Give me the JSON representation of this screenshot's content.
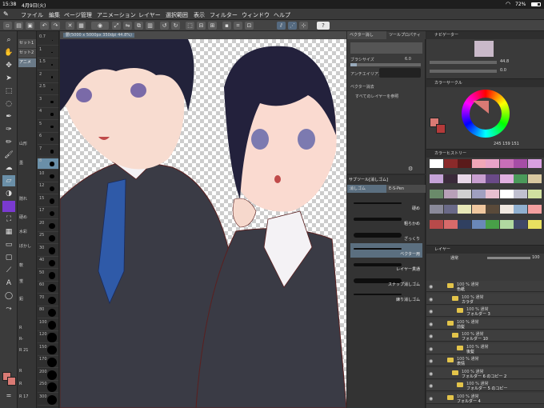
{
  "status_bar": {
    "time": "15:38",
    "date": "4月9日(火)",
    "battery": "72%"
  },
  "menu": [
    "ファイル",
    "編集",
    "ページ管理",
    "アニメーション",
    "レイヤー",
    "選択範囲",
    "表示",
    "フィルター",
    "ウィンドウ",
    "ヘルプ"
  ],
  "canvas": {
    "tab_label": "鬱(5000 x 5000px 350dpi 44.8%)"
  },
  "subtool_tabs": [
    "セット1",
    "セット2",
    "アニメ"
  ],
  "subtool_labels": [
    "山形",
    "墨",
    "隠れ",
    "硬め",
    "水彩",
    "ぼかし",
    "軟",
    "蛍",
    "鉛",
    "R",
    "R-",
    "R 21",
    "R",
    "R",
    "R 17"
  ],
  "brush_sizes": [
    "0.7",
    "1",
    "1.5",
    "2",
    "2.5",
    "3",
    "4",
    "5",
    "6",
    "7",
    "8",
    "10",
    "12",
    "15",
    "17",
    "20",
    "25",
    "30",
    "40",
    "50",
    "60",
    "70",
    "80",
    "100",
    "120",
    "150",
    "170",
    "200",
    "250",
    "300"
  ],
  "tool_property": {
    "tabs": [
      "ベクター消し",
      "ツールプロパティ"
    ],
    "brush_size_label": "ブラシサイズ",
    "brush_size_value": "6.0",
    "antialias_label": "アンチエイリアス",
    "vector_erase_label": "ベクター消去",
    "all_layers_label": "すべてのレイヤーを参照"
  },
  "subtool_panel": {
    "title": "サブツール[消しゴム]",
    "tabs": [
      "消しゴム",
      "E-S-Pen"
    ],
    "brushes": [
      "硬め",
      "粗らかめ",
      "ざっくり",
      "ベクター用",
      "レイヤー貫通",
      "スナップ消しゴム",
      "練り消しゴム"
    ]
  },
  "navigator": {
    "title": "ナビゲーター",
    "zoom": "44.8",
    "angle": "0.0"
  },
  "color_circle": {
    "title": "カラーサークル",
    "readout": "245 159 151"
  },
  "color_history": {
    "title": "カラーヒストリー"
  },
  "layers": {
    "title": "レイヤー",
    "blend": "通常",
    "opacity": "100",
    "rows": [
      {
        "mode": "100 % 通常",
        "name": "色紙"
      },
      {
        "mode": "100 % 通常",
        "name": "カラダ"
      },
      {
        "mode": "100 % 通常",
        "name": "フォルダー 3"
      },
      {
        "mode": "100 % 通常",
        "name": "前髪"
      },
      {
        "mode": "100 % 通常",
        "name": "フォルダー 10"
      },
      {
        "mode": "100 % 通常",
        "name": "後髪"
      },
      {
        "mode": "100 % 通常",
        "name": "表情"
      },
      {
        "mode": "100 % 通常",
        "name": "フォルダー 6 のコピー 2"
      },
      {
        "mode": "100 % 通常",
        "name": "フォルダー 5 のコピー"
      },
      {
        "mode": "100 % 通常",
        "name": "フォルダー 4"
      }
    ]
  },
  "colors": {
    "main": "#d97a74",
    "sub": "#d97a74",
    "history": [
      "#ffffff",
      "#8b2a2a",
      "#5a1a1a",
      "#f2a7b8",
      "#e9a3c8",
      "#c86fb8",
      "#a64da6",
      "#d8a0e0",
      "#c5a3d8",
      "#3a2a3a",
      "#e8d8e8",
      "#c89fd0",
      "#6a4a88",
      "#e0b0e0",
      "#4a9a5a",
      "#d8c8a0",
      "#6a8a6a",
      "#b8a0b8",
      "#d0d0d0",
      "#a0a0c0",
      "#e8c0d0",
      "#ffffff",
      "#c0c0d0",
      "#d0e0a0",
      "#8a8a9a",
      "#6a6a88",
      "#e8e8b8",
      "#f0c8a0",
      "#5a4a3a",
      "#f0e8e0",
      "#90b0d0",
      "#f4a0a0",
      "#b84a4a",
      "#d86a6a",
      "#304060",
      "#6a88b8",
      "#48a048",
      "#b0d8a0",
      "#404868",
      "#e8e060"
    ]
  }
}
